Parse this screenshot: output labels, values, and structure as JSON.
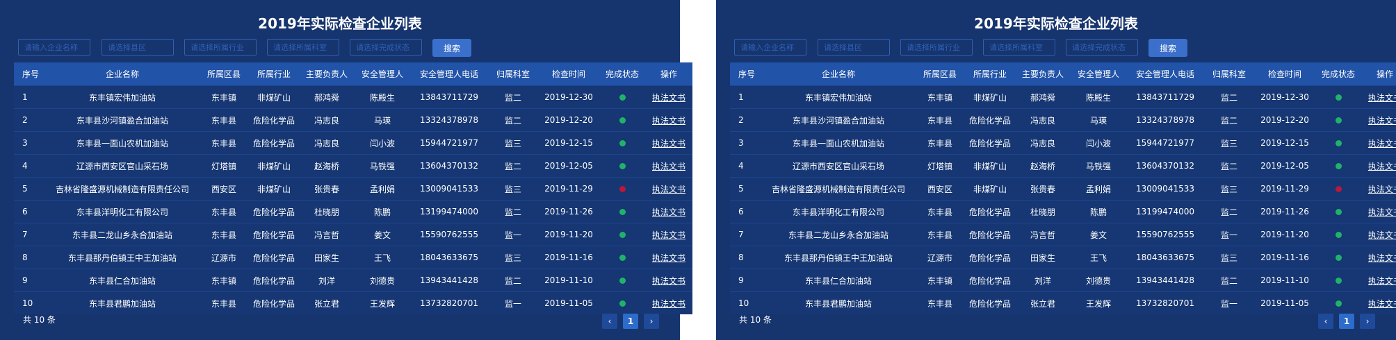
{
  "title": "2019年实际检查企业列表",
  "filters": {
    "company_placeholder": "请输入企业名称",
    "district_placeholder": "请选择县区",
    "industry_placeholder": "请选择所属行业",
    "office_placeholder": "请选择所属科室",
    "status_placeholder": "请选择完成状态",
    "search_label": "搜索"
  },
  "columns": [
    "序号",
    "企业名称",
    "所属区县",
    "所属行业",
    "主要负责人",
    "安全管理人",
    "安全管理人电话",
    "归属科室",
    "检查时间",
    "完成状态",
    "操作"
  ],
  "rows": [
    {
      "no": "1",
      "name": "东丰镇宏伟加油站",
      "district": "东丰镇",
      "industry": "非煤矿山",
      "principal": "郝鸿舜",
      "safety": "陈殿生",
      "phone": "13843711729",
      "office": "监二",
      "date": "2019-12-30",
      "status": "complete",
      "action": "执法文书"
    },
    {
      "no": "2",
      "name": "东丰县沙河镇盈合加油站",
      "district": "东丰县",
      "industry": "危险化学品",
      "principal": "冯志良",
      "safety": "马瑛",
      "phone": "13324378978",
      "office": "监二",
      "date": "2019-12-20",
      "status": "complete",
      "action": "执法文书"
    },
    {
      "no": "3",
      "name": "东丰县一面山农机加油站",
      "district": "东丰县",
      "industry": "危险化学品",
      "principal": "冯志良",
      "safety": "闫小波",
      "phone": "15944721977",
      "office": "监三",
      "date": "2019-12-15",
      "status": "complete",
      "action": "执法文书"
    },
    {
      "no": "4",
      "name": "辽源市西安区官山采石场",
      "district": "灯塔镇",
      "industry": "非煤矿山",
      "principal": "赵海桥",
      "safety": "马铁强",
      "phone": "13604370132",
      "office": "监二",
      "date": "2019-12-05",
      "status": "complete",
      "action": "执法文书"
    },
    {
      "no": "5",
      "name": "吉林省隆盛源机械制造有限责任公司",
      "district": "西安区",
      "industry": "非煤矿山",
      "principal": "张贵春",
      "safety": "孟利娟",
      "phone": "13009041533",
      "office": "监三",
      "date": "2019-11-29",
      "status": "incomplete",
      "action": "执法文书"
    },
    {
      "no": "6",
      "name": "东丰县洋明化工有限公司",
      "district": "东丰县",
      "industry": "危险化学品",
      "principal": "杜晓朋",
      "safety": "陈鹏",
      "phone": "13199474000",
      "office": "监二",
      "date": "2019-11-26",
      "status": "complete",
      "action": "执法文书"
    },
    {
      "no": "7",
      "name": "东丰县二龙山乡永合加油站",
      "district": "东丰县",
      "industry": "危险化学品",
      "principal": "冯言哲",
      "safety": "姜文",
      "phone": "15590762555",
      "office": "监一",
      "date": "2019-11-20",
      "status": "complete",
      "action": "执法文书"
    },
    {
      "no": "8",
      "name": "东丰县那丹伯镇王中王加油站",
      "district": "辽源市",
      "industry": "危险化学品",
      "principal": "田家生",
      "safety": "王飞",
      "phone": "18043633675",
      "office": "监三",
      "date": "2019-11-16",
      "status": "complete",
      "action": "执法文书"
    },
    {
      "no": "9",
      "name": "东丰县仁合加油站",
      "district": "东丰镇",
      "industry": "危险化学品",
      "principal": "刘洋",
      "safety": "刘德贵",
      "phone": "13943441428",
      "office": "监二",
      "date": "2019-11-10",
      "status": "complete",
      "action": "执法文书"
    },
    {
      "no": "10",
      "name": "东丰县君鹏加油站",
      "district": "东丰县",
      "industry": "危险化学品",
      "principal": "张立君",
      "safety": "王发辉",
      "phone": "13732820701",
      "office": "监一",
      "date": "2019-11-05",
      "status": "complete",
      "action": "执法文书"
    }
  ],
  "status_colors": {
    "complete": "#21b26a",
    "incomplete": "#b8183a"
  },
  "footer": {
    "total": "共 10 条"
  },
  "pagination": {
    "prev": "‹",
    "current": "1",
    "next": "›"
  }
}
